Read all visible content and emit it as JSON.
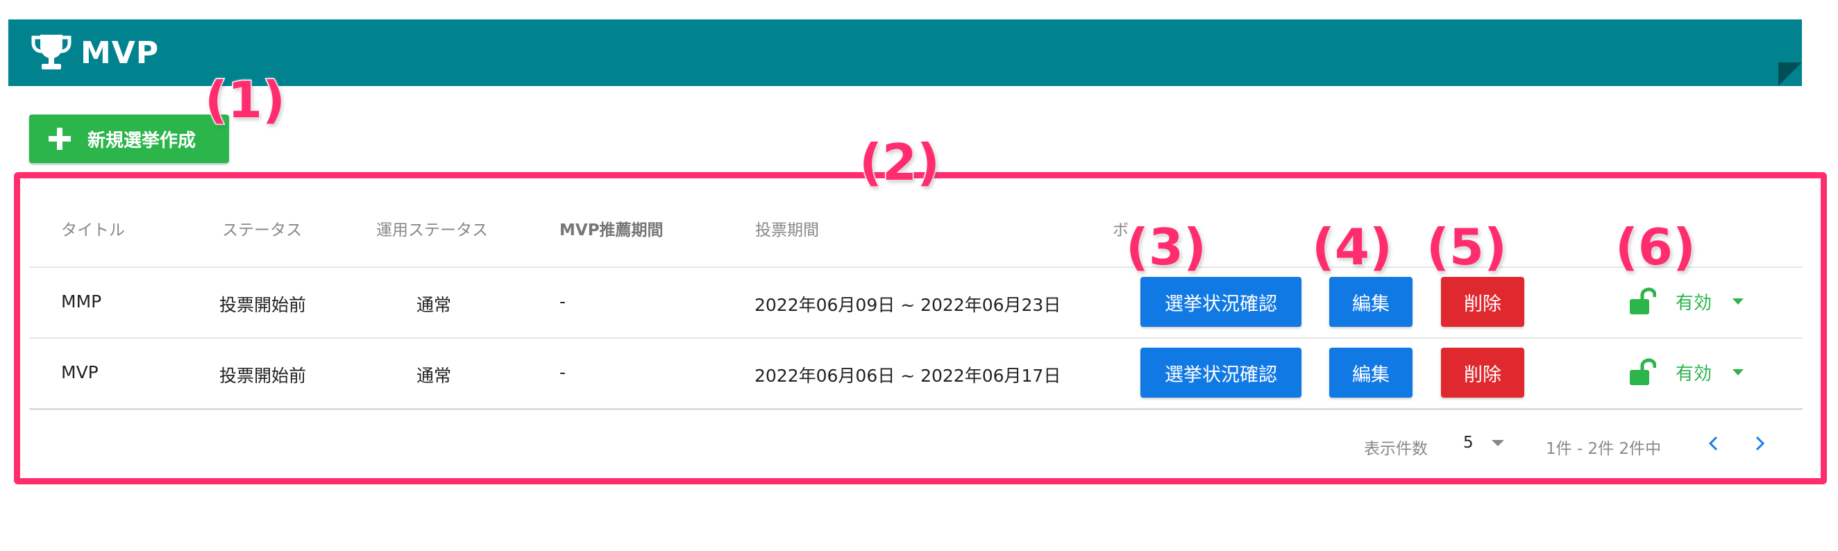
{
  "header": {
    "title": "MVP",
    "icon": "trophy-icon"
  },
  "new_button": {
    "label": "新規選挙作成",
    "icon": "plus-icon"
  },
  "callouts": [
    "(1)",
    "(2)",
    "(3)",
    "(4)",
    "(5)",
    "(6)"
  ],
  "table": {
    "columns": [
      "タイトル",
      "ステータス",
      "運用ステータス",
      "MVP推薦期間",
      "投票期間",
      "ボ"
    ],
    "rows": [
      {
        "title": "MMP",
        "status": "投票開始前",
        "ops_status": "通常",
        "mvp_period": "-",
        "vote_period": "2022年06月09日 ~ 2022年06月23日",
        "check_label": "選挙状況確認",
        "edit_label": "編集",
        "delete_label": "削除",
        "state_label": "有効"
      },
      {
        "title": "MVP",
        "status": "投票開始前",
        "ops_status": "通常",
        "mvp_period": "-",
        "vote_period": "2022年06月06日 ~ 2022年06月17日",
        "check_label": "選挙状況確認",
        "edit_label": "編集",
        "delete_label": "削除",
        "state_label": "有効"
      }
    ]
  },
  "footer": {
    "per_page_label": "表示件数",
    "per_page_value": "5",
    "range_text": "1件 - 2件 2件中"
  },
  "colors": {
    "banner": "#00838f",
    "green": "#2bb54b",
    "blue": "#1179e4",
    "red": "#e0292f",
    "callout": "#ff2d6e"
  }
}
